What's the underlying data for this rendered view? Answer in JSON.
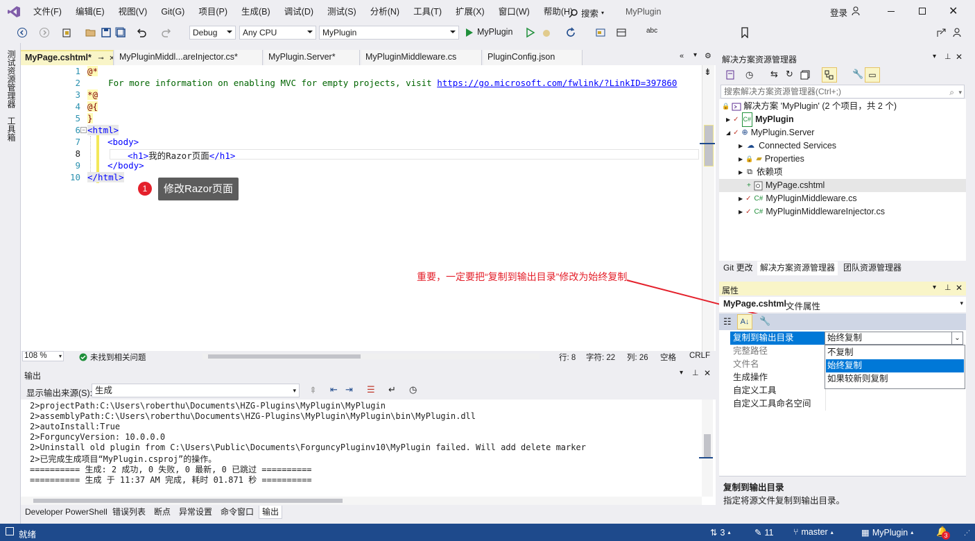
{
  "title_bar": {
    "menus": [
      "文件(F)",
      "编辑(E)",
      "视图(V)",
      "Git(G)",
      "项目(P)",
      "生成(B)",
      "调试(D)",
      "测试(S)",
      "分析(N)",
      "工具(T)",
      "扩展(X)",
      "窗口(W)",
      "帮助(H)"
    ],
    "search_label": "搜索",
    "solution_name": "MyPlugin",
    "login_label": "登录"
  },
  "toolbar": {
    "config": "Debug",
    "platform": "Any CPU",
    "startup_project": "MyPlugin",
    "run_label": "MyPlugin"
  },
  "left_strip": {
    "tab1": "测试资源管理器",
    "tab2": "工具箱"
  },
  "doc_tabs": [
    {
      "label": "MyPage.cshtml*",
      "active": true
    },
    {
      "label": "MyPluginMiddl...areInjector.cs*"
    },
    {
      "label": "MyPlugin.Server*"
    },
    {
      "label": "MyPluginMiddleware.cs"
    },
    {
      "label": "PluginConfig.json"
    }
  ],
  "editor": {
    "line_numbers": [
      "1",
      "2",
      "3",
      "4",
      "5",
      "6",
      "7",
      "8",
      "9",
      "10"
    ],
    "line1": "@*",
    "line2_text": "    For more information on enabling MVC for empty projects, visit ",
    "line2_link": "https://go.microsoft.com/fwlink/?LinkID=397860",
    "line3": "*@",
    "line4": "@{",
    "line5": "}",
    "line6": "<html>",
    "line7": "<body>",
    "line8_open": "<h1>",
    "line8_text": "我的Razor页面",
    "line8_close": "</h1>",
    "line9": "</body>",
    "line10": "</html>",
    "callout_number": "1",
    "callout_text": "修改Razor页面",
    "zoom": "108 %",
    "issues": "未找到相关问题",
    "row": "行: 8",
    "char": "字符: 22",
    "col": "列: 26",
    "indent": "空格",
    "eol": "CRLF"
  },
  "output": {
    "title": "输出",
    "source_label": "显示输出来源(S):",
    "source_value": "生成",
    "lines": [
      "2>projectPath:C:\\Users\\roberthu\\Documents\\HZG-Plugins\\MyPlugin\\MyPlugin",
      "2>assemblyPath:C:\\Users\\roberthu\\Documents\\HZG-Plugins\\MyPlugin\\MyPlugin\\bin\\MyPlugin.dll",
      "2>autoInstall:True",
      "2>ForguncyVersion: 10.0.0.0",
      "2>Uninstall old plugin from C:\\Users\\Public\\Documents\\ForguncyPluginv10\\MyPlugin failed. Will add delete marker",
      "2>已完成生成项目“MyPlugin.csproj”的操作。",
      "========== 生成: 2 成功, 0 失败, 0 最新, 0 已跳过 ==========",
      "========== 生成 于 11:37 AM 完成, 耗时 01.871 秒 =========="
    ]
  },
  "bottom_tabs": [
    "Developer PowerShell",
    "错误列表",
    "断点",
    "异常设置",
    "命令窗口",
    "输出"
  ],
  "solution_explorer": {
    "title": "解决方案资源管理器",
    "search_placeholder": "搜索解决方案资源管理器(Ctrl+;)",
    "solution_node": "解决方案 'MyPlugin' (2 个项目，共 2 个)",
    "nodes": [
      "MyPlugin",
      "MyPlugin.Server",
      "Connected Services",
      "Properties",
      "依赖项",
      "MyPage.cshtml",
      "MyPluginMiddleware.cs",
      "MyPluginMiddlewareInjector.cs"
    ],
    "tabs": [
      "Git 更改",
      "解决方案资源管理器",
      "团队资源管理器"
    ]
  },
  "annotation": "重要，一定要把“复制到输出目录”修改为始终复制",
  "properties": {
    "title": "属性",
    "file_name": "MyPage.cshtml",
    "file_type": "文件属性",
    "rows": [
      "复制到输出目录",
      "完整路径",
      "文件名",
      "生成操作",
      "自定义工具",
      "自定义工具命名空间"
    ],
    "selected_value": "始终复制",
    "options": [
      "不复制",
      "始终复制",
      "如果较新则复制"
    ],
    "desc_title": "复制到输出目录",
    "desc_text": "指定将源文件复制到输出目录。"
  },
  "status_bar": {
    "ready": "就绪",
    "up_count": "3",
    "edit_count": "11",
    "branch": "master",
    "repo": "MyPlugin",
    "notif_count": "3"
  },
  "colors": {
    "status_bar": "#1e4a8c",
    "accent": "#0078d7",
    "annotation": "#e4202b"
  }
}
